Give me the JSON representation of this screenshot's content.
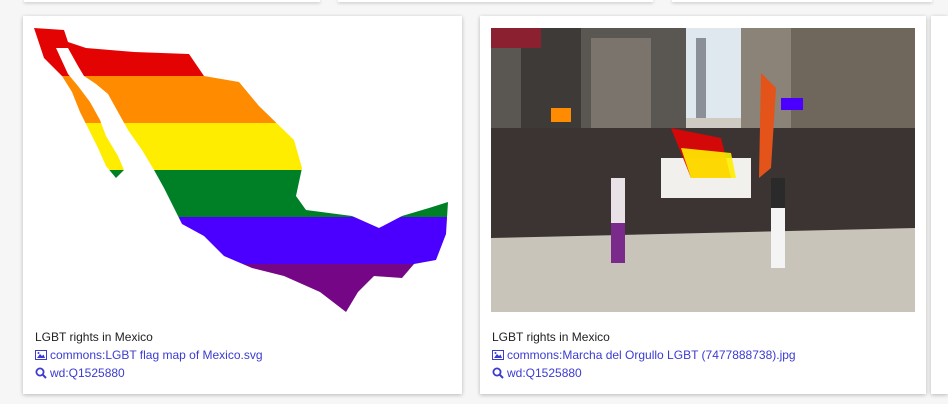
{
  "cards": [
    {
      "caption": "LGBT rights in Mexico",
      "file_link": "commons:LGBT flag map of Mexico.svg",
      "wd_link": "wd:Q1525880"
    },
    {
      "caption": "LGBT rights in Mexico",
      "file_link": "commons:Marcha del Orgullo LGBT (7477888738).jpg",
      "wd_link": "wd:Q1525880"
    }
  ],
  "colors": {
    "link": "#3b3bd0",
    "rainbow": [
      "#e40303",
      "#ff8c00",
      "#ffed00",
      "#008026",
      "#4b00ff",
      "#750787"
    ]
  }
}
